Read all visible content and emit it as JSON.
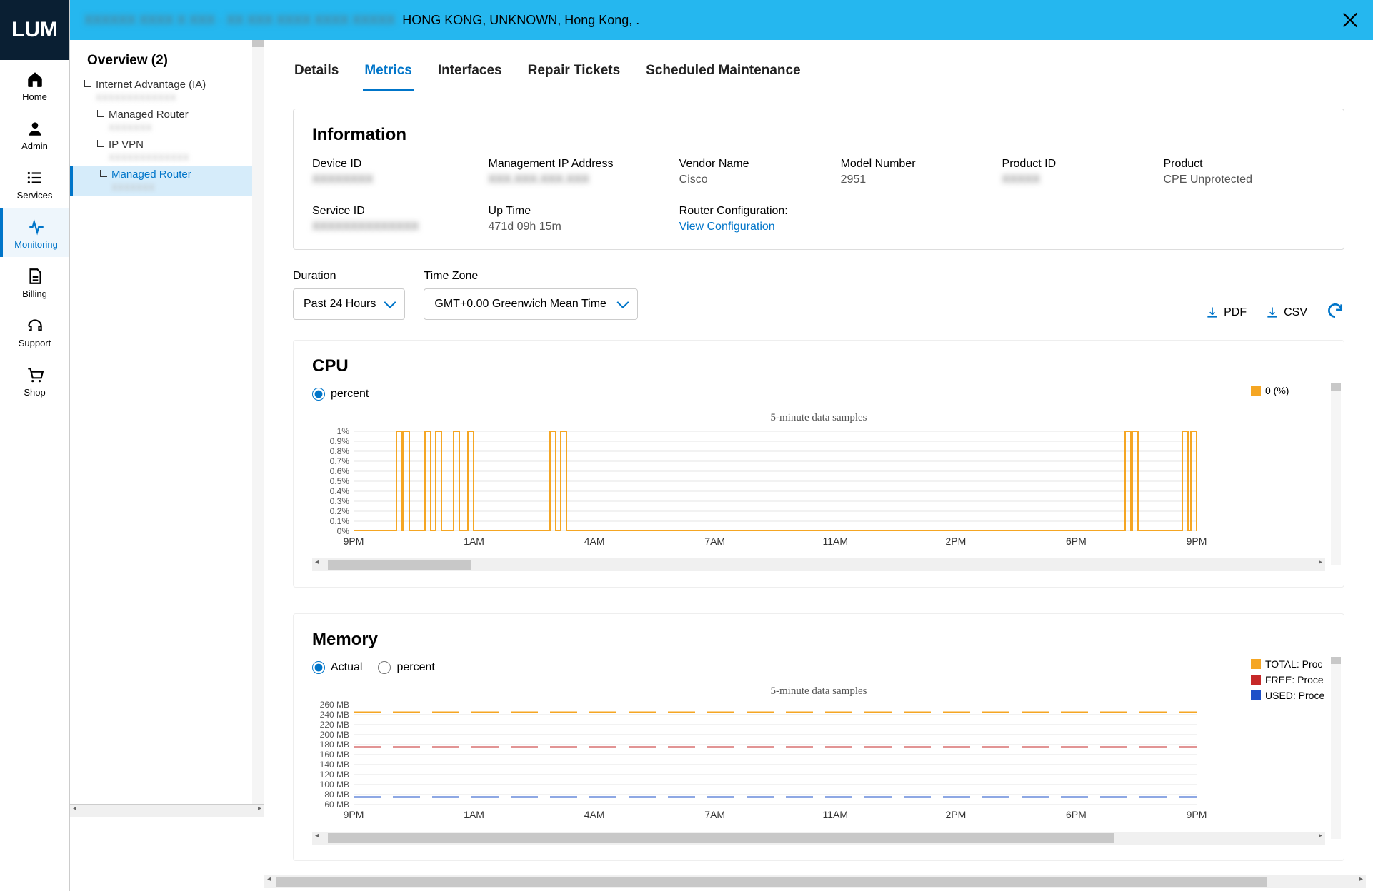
{
  "brand": "LUM",
  "leftnav": [
    {
      "icon": "home",
      "label": "Home"
    },
    {
      "icon": "user",
      "label": "Admin"
    },
    {
      "icon": "list",
      "label": "Services"
    },
    {
      "icon": "pulse",
      "label": "Monitoring",
      "active": true
    },
    {
      "icon": "doc",
      "label": "Billing"
    },
    {
      "icon": "headset",
      "label": "Support"
    },
    {
      "icon": "cart",
      "label": "Shop"
    }
  ],
  "topbar": {
    "blurred_prefix": "XXXXXX XXXX X XXX · XX XXX XXXX XXXX XXXXX",
    "location": "HONG KONG, UNKNOWN, Hong Kong, ."
  },
  "overview": {
    "title": "Overview (2)",
    "items": [
      {
        "label": "Internet Advantage (IA)",
        "sub": "XXXXXXXXXXXXX",
        "lvl": 1
      },
      {
        "label": "Managed Router",
        "sub": "XXXXXXX",
        "lvl": 2
      },
      {
        "label": "IP VPN",
        "sub": "XXXXXXXXXXXXX",
        "lvl": 3
      },
      {
        "label": "Managed Router",
        "sub": "XXXXXXX",
        "lvl": 4,
        "active": true
      }
    ]
  },
  "tabs": [
    "Details",
    "Metrics",
    "Interfaces",
    "Repair Tickets",
    "Scheduled Maintenance"
  ],
  "active_tab": "Metrics",
  "info": {
    "title": "Information",
    "fields": [
      {
        "k": "Device ID",
        "v": "XXXXXXXX",
        "blur": true
      },
      {
        "k": "Management IP Address",
        "v": "XXX.XXX.XXX.XXX",
        "blur": true
      },
      {
        "k": "Vendor Name",
        "v": "Cisco"
      },
      {
        "k": "Model Number",
        "v": "2951"
      },
      {
        "k": "Product ID",
        "v": "XXXXX",
        "blur": true
      },
      {
        "k": "Product",
        "v": "CPE Unprotected"
      },
      {
        "k": "Service ID",
        "v": "XXXXXXXXXXXXXX",
        "blur": true
      },
      {
        "k": "Up Time",
        "v": "471d 09h 15m"
      },
      {
        "k": "Router Configuration:",
        "v": "View Configuration",
        "link": true
      }
    ]
  },
  "controls": {
    "duration": {
      "label": "Duration",
      "value": "Past 24 Hours"
    },
    "timezone": {
      "label": "Time Zone",
      "value": "GMT+0.00 Greenwich Mean Time"
    },
    "pdf": "PDF",
    "csv": "CSV"
  },
  "cpu": {
    "title": "CPU",
    "radio": "percent",
    "subtitle": "5-minute data samples",
    "legend": [
      {
        "color": "or",
        "label": "0 (%)"
      }
    ],
    "yticks": [
      "1%",
      "0.9%",
      "0.8%",
      "0.7%",
      "0.6%",
      "0.5%",
      "0.4%",
      "0.3%",
      "0.2%",
      "0.1%",
      "0%"
    ],
    "xticks": [
      "9PM",
      "1AM",
      "4AM",
      "7AM",
      "11AM",
      "2PM",
      "6PM",
      "9PM"
    ]
  },
  "memory": {
    "title": "Memory",
    "radio_actual": "Actual",
    "radio_percent": "percent",
    "subtitle": "5-minute data samples",
    "legend": [
      {
        "color": "or",
        "label": "TOTAL: Proc"
      },
      {
        "color": "rd",
        "label": "FREE: Proce"
      },
      {
        "color": "bl",
        "label": "USED: Proce"
      }
    ],
    "yticks": [
      "260 MB",
      "240 MB",
      "220 MB",
      "200 MB",
      "180 MB",
      "160 MB",
      "140 MB",
      "120 MB",
      "100 MB",
      "80 MB",
      "60 MB"
    ],
    "xticks": [
      "9PM",
      "1AM",
      "4AM",
      "7AM",
      "11AM",
      "2PM",
      "6PM",
      "9PM"
    ]
  },
  "chart_data": [
    {
      "type": "line",
      "title": "CPU — 5-minute data samples",
      "ylabel": "percent",
      "ylim": [
        0,
        1
      ],
      "x_categories": [
        "9PM",
        "1AM",
        "4AM",
        "7AM",
        "11AM",
        "2PM",
        "6PM",
        "9PM"
      ],
      "note": "CPU utilization is essentially 0% with brief 1% spikes",
      "series": [
        {
          "name": "0 (%)",
          "color": "#f5a623",
          "spikes_at_x": [
            60,
            70,
            100,
            115,
            140,
            160,
            275,
            290,
            1080,
            1090,
            1160,
            1172
          ],
          "baseline": 0,
          "spike_value": 1
        }
      ]
    },
    {
      "type": "line",
      "title": "Memory — 5-minute data samples",
      "ylabel": "MB",
      "ylim": [
        60,
        260
      ],
      "x_categories": [
        "9PM",
        "1AM",
        "4AM",
        "7AM",
        "11AM",
        "2PM",
        "6PM",
        "9PM"
      ],
      "series": [
        {
          "name": "TOTAL: Proc",
          "color": "#f5a623",
          "constant_value": 245
        },
        {
          "name": "FREE: Proce",
          "color": "#c62828",
          "constant_value": 175
        },
        {
          "name": "USED: Proce",
          "color": "#1e50c8",
          "constant_value": 75
        }
      ]
    }
  ]
}
